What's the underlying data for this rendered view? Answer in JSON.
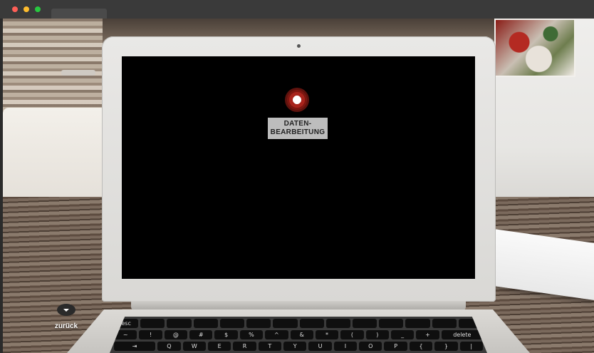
{
  "window": {
    "controls": [
      "close",
      "minimize",
      "maximize"
    ]
  },
  "laptop": {
    "hotspot": {
      "label": "DATEN-\nBEARBEITUNG",
      "icon": "record-target-icon",
      "color": "#a8241c"
    }
  },
  "navigation": {
    "back_label": "zurück",
    "back_icon": "chevron-down-icon"
  },
  "keyboard": {
    "row1": [
      "esc",
      "",
      "",
      "",
      "",
      "",
      "",
      "",
      "",
      "",
      "",
      "",
      "",
      ""
    ],
    "row2": [
      "~",
      "!",
      "@",
      "#",
      "$",
      "%",
      "^",
      "&",
      "*",
      "(",
      ")",
      "_",
      "+",
      "delete"
    ],
    "row3": [
      "⇥",
      "Q",
      "W",
      "E",
      "R",
      "T",
      "Y",
      "U",
      "I",
      "O",
      "P",
      "{",
      "}",
      "|"
    ]
  }
}
